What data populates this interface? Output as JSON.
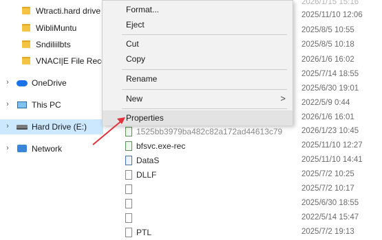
{
  "nav": {
    "folders": [
      {
        "label": "Wtracti.hard drive"
      },
      {
        "label": "WibliMuntu"
      },
      {
        "label": "Sndiliilbts"
      },
      {
        "label": "VNACI|E File Reco"
      }
    ],
    "items": [
      {
        "label": "OneDrive",
        "icon": "onedrive-cloud-icon"
      },
      {
        "label": "This PC",
        "icon": "this-pc-icon"
      },
      {
        "label": "Hard Drive (E:)",
        "icon": "hard-drive-icon",
        "selected": true
      },
      {
        "label": "Network",
        "icon": "network-icon"
      }
    ]
  },
  "files": [
    {
      "name": "",
      "date": "2026/1/15 15:16",
      "faded": true
    },
    {
      "name": "",
      "date": "2025/11/10 12:06"
    },
    {
      "name": "",
      "date": "2025/8/5 10:55"
    },
    {
      "name": "",
      "date": "2025/8/5 10:18"
    },
    {
      "name": "",
      "date": "2026/1/6 16:02"
    },
    {
      "name": "",
      "date": "2025/7/14 18:55"
    },
    {
      "name": "",
      "date": "2025/6/30 19:01"
    },
    {
      "name": "",
      "date": "2022/5/9 0:44"
    },
    {
      "name": "",
      "date": "2026/1/6 16:01"
    },
    {
      "name": "1525bb3979ba482c82a172ad44613c79",
      "date": "2026/1/23 10:45",
      "icon": "exe"
    },
    {
      "name": "bfsvc.exe-rec",
      "date": "2025/11/10 12:27",
      "icon": "exe"
    },
    {
      "name": "DataS",
      "date": "2025/11/10 14:41",
      "icon": "data"
    },
    {
      "name": "DLLF",
      "date": "2025/7/2 10:25"
    },
    {
      "name": "",
      "date": "2025/7/2 10:17"
    },
    {
      "name": "",
      "date": "2025/6/30 18:55"
    },
    {
      "name": "",
      "date": "2022/5/14 15:47"
    },
    {
      "name": "PTL",
      "date": "2025/7/2 19:13"
    }
  ],
  "context_menu": {
    "items": [
      {
        "label": "Format..."
      },
      {
        "label": "Eject"
      },
      {
        "label": "Cut"
      },
      {
        "label": "Copy"
      },
      {
        "label": "Rename"
      },
      {
        "label": "New",
        "submenu": true
      },
      {
        "label": "Properties",
        "highlighted": true
      }
    ],
    "submenu_arrow": ">"
  },
  "annotation": {
    "color": "#e0303a"
  }
}
